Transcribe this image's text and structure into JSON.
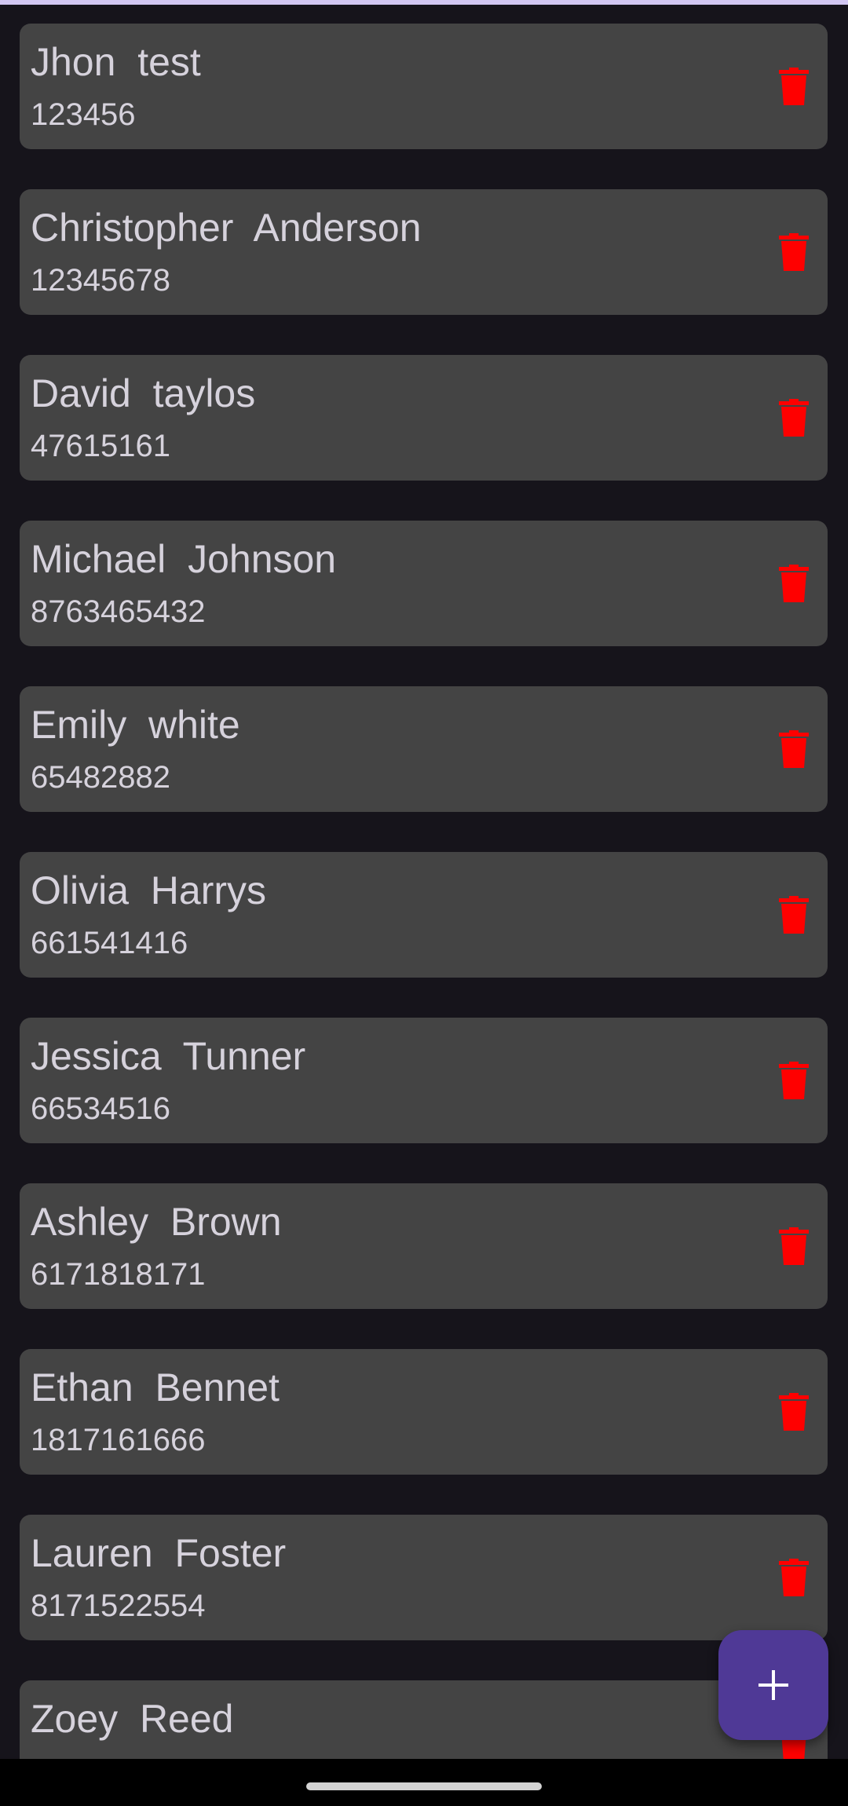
{
  "contacts": [
    {
      "name": "Jhon  test",
      "phone": "123456"
    },
    {
      "name": "Christopher  Anderson",
      "phone": "12345678"
    },
    {
      "name": "David  taylos",
      "phone": "47615161"
    },
    {
      "name": "Michael  Johnson",
      "phone": "8763465432"
    },
    {
      "name": "Emily  white",
      "phone": "65482882"
    },
    {
      "name": "Olivia  Harrys",
      "phone": "661541416"
    },
    {
      "name": "Jessica  Tunner",
      "phone": "66534516"
    },
    {
      "name": "Ashley  Brown",
      "phone": "6171818171"
    },
    {
      "name": "Ethan  Bennet",
      "phone": "1817161666"
    },
    {
      "name": "Lauren  Foster",
      "phone": "8171522554"
    },
    {
      "name": "Zoey  Reed",
      "phone": ""
    }
  ],
  "icons": {
    "delete": "trash-icon",
    "add": "plus-icon"
  },
  "colors": {
    "background": "#16141b",
    "card": "#444444",
    "text": "#d6d2dc",
    "delete": "#ff0000",
    "fab": "#4f3996",
    "accent": "#d2c7f3"
  }
}
